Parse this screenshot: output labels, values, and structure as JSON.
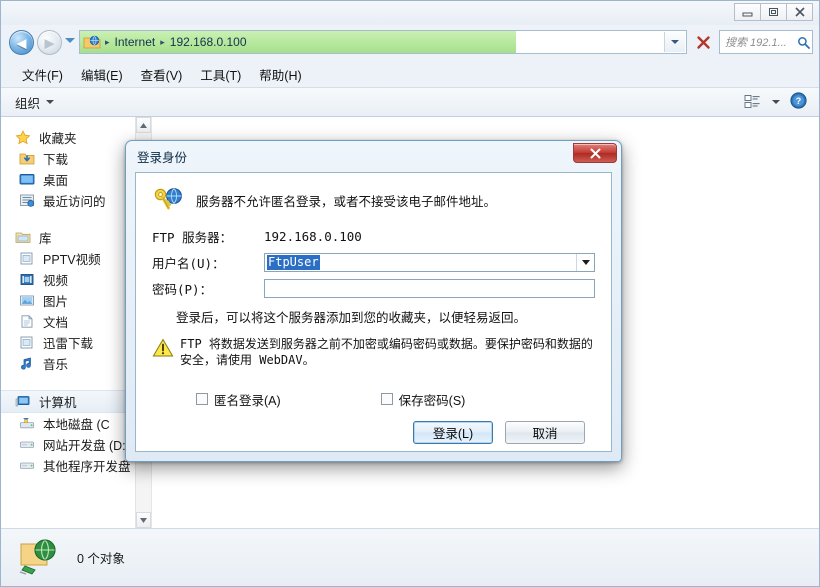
{
  "window": {
    "controls": {
      "minimize": "—",
      "restore": "❐",
      "close": "✕"
    }
  },
  "nav": {
    "back_label": "◀",
    "forward_label": "▶",
    "history_dropdown": "▾",
    "address": {
      "icon": "ftp-site-icon",
      "crumbs": [
        "Internet",
        "192.168.0.100"
      ],
      "separator": "▸",
      "dropdown": "▾"
    },
    "stop_label": "✕",
    "search": {
      "placeholder": "搜索 192.1...",
      "icon": "search-icon"
    }
  },
  "menubar": {
    "items": [
      {
        "label": "文件(F)"
      },
      {
        "label": "编辑(E)"
      },
      {
        "label": "查看(V)"
      },
      {
        "label": "工具(T)"
      },
      {
        "label": "帮助(H)"
      }
    ]
  },
  "toolbar": {
    "organize_label": "组织",
    "organize_caret": "▾",
    "view_caret": "▾",
    "help_label": "?"
  },
  "sidebar": {
    "groups": [
      {
        "header": {
          "label": "收藏夹",
          "icon": "star-icon"
        },
        "items": [
          {
            "label": "下载",
            "icon": "downloads-icon"
          },
          {
            "label": "桌面",
            "icon": "desktop-icon"
          },
          {
            "label": "最近访问的",
            "icon": "recent-places-icon"
          }
        ]
      },
      {
        "header": {
          "label": "库",
          "icon": "libraries-icon"
        },
        "items": [
          {
            "label": "PPTV视频",
            "icon": "folder-icon"
          },
          {
            "label": "视频",
            "icon": "videos-icon"
          },
          {
            "label": "图片",
            "icon": "pictures-icon"
          },
          {
            "label": "文档",
            "icon": "documents-icon"
          },
          {
            "label": "迅雷下载",
            "icon": "folder-icon"
          },
          {
            "label": "音乐",
            "icon": "music-icon"
          }
        ]
      },
      {
        "header": {
          "label": "计算机",
          "icon": "computer-icon"
        },
        "items": [
          {
            "label": "本地磁盘 (C",
            "icon": "system-drive-icon"
          },
          {
            "label": "网站开发盘 (D:)",
            "icon": "drive-icon"
          },
          {
            "label": "其他程序开发盘",
            "icon": "drive-icon"
          }
        ]
      }
    ]
  },
  "statusbar": {
    "icon": "ftp-folder-icon",
    "text": "0 个对象"
  },
  "dialog": {
    "title": "登录身份",
    "close_label": "✕",
    "icon": "key-globe-icon",
    "message": "服务器不允许匿名登录，或者不接受该电子邮件地址。",
    "fields": {
      "server_label": "FTP 服务器：",
      "server_value": "192.168.0.100",
      "username_label": "用户名(U)：",
      "username_value": "FtpUser",
      "username_dropdown": "▾",
      "password_label": "密码(P)：",
      "password_value": ""
    },
    "note": "登录后，可以将这个服务器添加到您的收藏夹，以便轻易返回。",
    "warning_icon": "warning-icon",
    "warning": "FTP 将数据发送到服务器之前不加密或编码密码或数据。要保护密码和数据的安全，请使用 WebDAV。",
    "checkboxes": [
      {
        "label": "匿名登录(A)",
        "checked": false
      },
      {
        "label": "保存密码(S)",
        "checked": false
      }
    ],
    "buttons": {
      "login": "登录(L)",
      "cancel": "取消"
    }
  },
  "colors": {
    "address_progress": "#a6e08b",
    "selection_blue": "#2b6fc4",
    "close_red": "#c43c33",
    "accent": "#3a79ad"
  }
}
